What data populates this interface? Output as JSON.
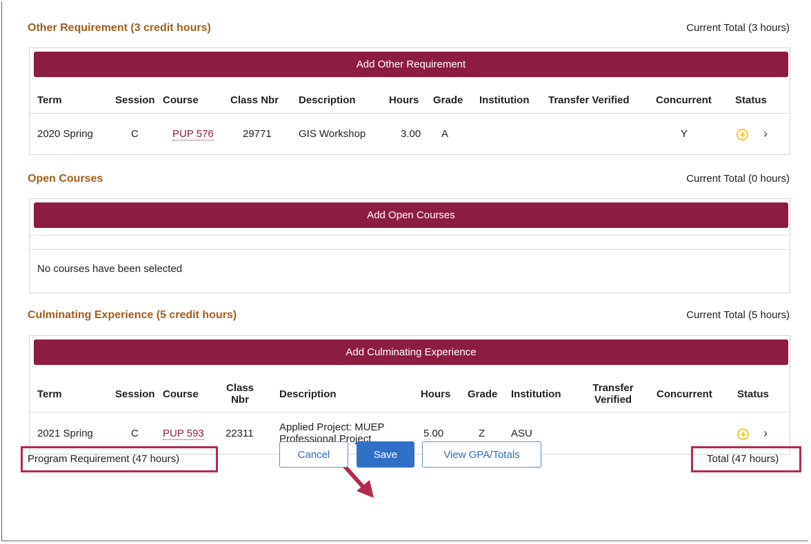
{
  "other": {
    "title": "Other Requirement (3 credit hours)",
    "total": "Current Total (3 hours)",
    "add_label": "Add Other Requirement",
    "headers": {
      "term": "Term",
      "session": "Session",
      "course": "Course",
      "classnbr": "Class Nbr",
      "description": "Description",
      "hours": "Hours",
      "grade": "Grade",
      "institution": "Institution",
      "transfer": "Transfer Verified",
      "concurrent": "Concurrent",
      "status": "Status"
    },
    "rows": [
      {
        "term": "2020 Spring",
        "session": "C",
        "course": "PUP 576",
        "classnbr": "29771",
        "description": "GIS Workshop",
        "hours": "3.00",
        "grade": "A",
        "institution": "",
        "transfer": "",
        "concurrent": "Y"
      }
    ]
  },
  "open": {
    "title": "Open Courses",
    "total": "Current Total (0 hours)",
    "add_label": "Add Open Courses",
    "empty_message": "No courses have been selected"
  },
  "culminating": {
    "title": "Culminating Experience (5 credit hours)",
    "total": "Current Total (5 hours)",
    "add_label": "Add Culminating Experience",
    "headers": {
      "term": "Term",
      "session": "Session",
      "course": "Course",
      "classnbr_1": "Class",
      "classnbr_2": "Nbr",
      "description": "Description",
      "hours": "Hours",
      "grade": "Grade",
      "institution": "Institution",
      "transfer_1": "Transfer",
      "transfer_2": "Verified",
      "concurrent": "Concurrent",
      "status": "Status"
    },
    "rows": [
      {
        "term": "2021 Spring",
        "session": "C",
        "course": "PUP 593",
        "classnbr": "22311",
        "description_1": "Applied Project: MUEP",
        "description_2": "Professional Project",
        "hours": "5.00",
        "grade": "Z",
        "institution": "ASU",
        "transfer": "",
        "concurrent": ""
      }
    ]
  },
  "footer": {
    "program_requirement": "Program Requirement (47 hours)",
    "total": "Total (47 hours)",
    "cancel_label": "Cancel",
    "save_label": "Save",
    "gpa_label": "View GPA/Totals"
  },
  "colors": {
    "accent": "#8c1d40",
    "title": "#a35d1d",
    "status_icon": "#ffc627",
    "annotation": "#b5294f",
    "primary_button": "#2f6fc8"
  }
}
